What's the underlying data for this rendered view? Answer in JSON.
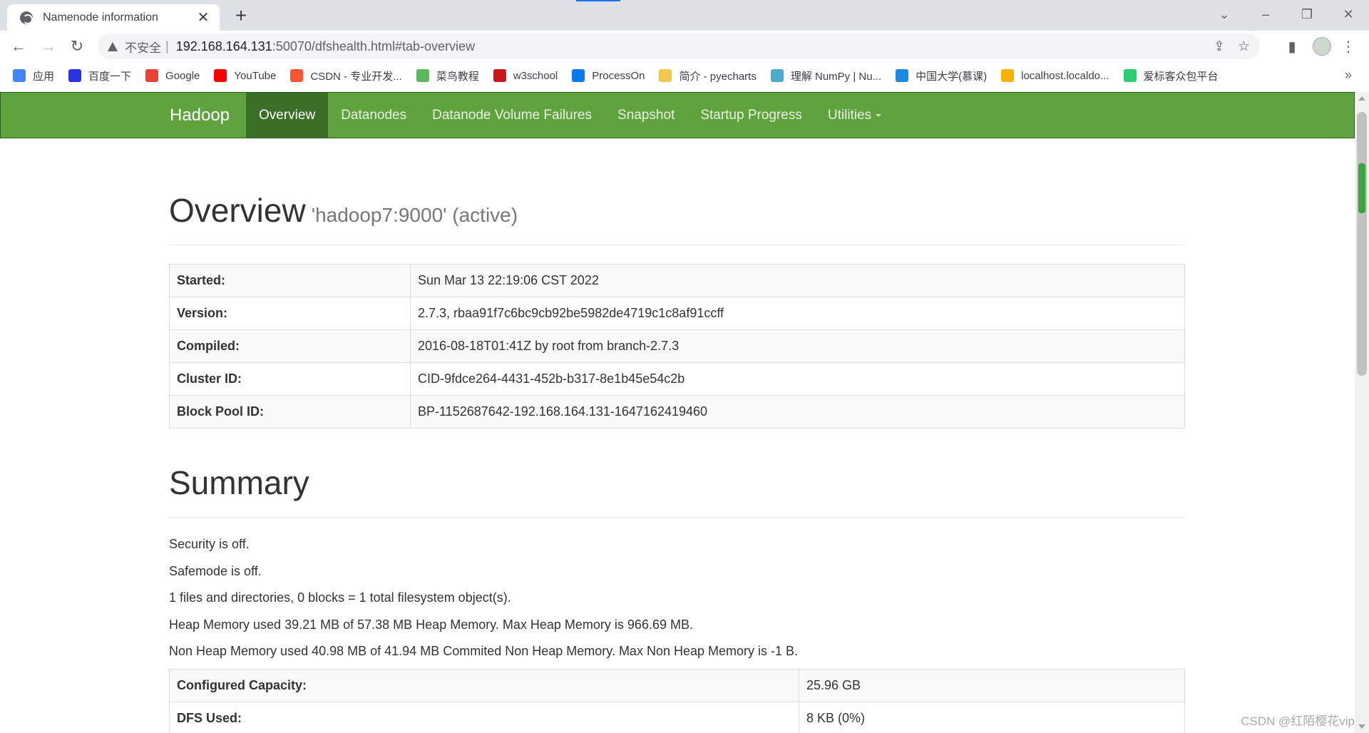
{
  "browser": {
    "tab_title": "Namenode information",
    "insecure_label": "不安全",
    "url_host": "192.168.164.131",
    "url_rest": ":50070/dfshealth.html#tab-overview"
  },
  "bookmarks": [
    {
      "label": "应用",
      "icon": "apps-grid-icon",
      "color": "#4285f4"
    },
    {
      "label": "百度一下",
      "icon": "baidu-icon",
      "color": "#2932e1"
    },
    {
      "label": "Google",
      "icon": "google-icon",
      "color": "#ea4335"
    },
    {
      "label": "YouTube",
      "icon": "youtube-icon",
      "color": "#ff0000"
    },
    {
      "label": "CSDN - 专业开发...",
      "icon": "csdn-icon",
      "color": "#fc5531"
    },
    {
      "label": "菜鸟教程",
      "icon": "runoob-icon",
      "color": "#5cb85c"
    },
    {
      "label": "w3school",
      "icon": "w3school-icon",
      "color": "#c7161d"
    },
    {
      "label": "ProcessOn",
      "icon": "processon-icon",
      "color": "#067bef"
    },
    {
      "label": "简介 - pyecharts",
      "icon": "pyecharts-icon",
      "color": "#f2c94c"
    },
    {
      "label": "理解 NumPy | Nu...",
      "icon": "numpy-icon",
      "color": "#4dabcf"
    },
    {
      "label": "中国大学(慕课)",
      "icon": "mooc-icon",
      "color": "#1e88e5"
    },
    {
      "label": "localhost.localdo...",
      "icon": "localhost-icon",
      "color": "#f4b400"
    },
    {
      "label": "爱标客众包平台",
      "icon": "aibiaoke-icon",
      "color": "#2ecc71"
    }
  ],
  "navbar": {
    "brand": "Hadoop",
    "items": [
      "Overview",
      "Datanodes",
      "Datanode Volume Failures",
      "Snapshot",
      "Startup Progress",
      "Utilities"
    ],
    "active_index": 0,
    "color": "#5fa33e"
  },
  "overview": {
    "title": "Overview",
    "subtitle": "'hadoop7:9000' (active)",
    "rows": [
      {
        "key": "Started:",
        "value": "Sun Mar 13 22:19:06 CST 2022"
      },
      {
        "key": "Version:",
        "value": "2.7.3, rbaa91f7c6bc9cb92be5982de4719c1c8af91ccff"
      },
      {
        "key": "Compiled:",
        "value": "2016-08-18T01:41Z by root from branch-2.7.3"
      },
      {
        "key": "Cluster ID:",
        "value": "CID-9fdce264-4431-452b-b317-8e1b45e54c2b"
      },
      {
        "key": "Block Pool ID:",
        "value": "BP-1152687642-192.168.164.131-1647162419460"
      }
    ]
  },
  "summary": {
    "title": "Summary",
    "lines": [
      "Security is off.",
      "Safemode is off.",
      "1 files and directories, 0 blocks = 1 total filesystem object(s).",
      "Heap Memory used 39.21 MB of 57.38 MB Heap Memory. Max Heap Memory is 966.69 MB.",
      "Non Heap Memory used 40.98 MB of 41.94 MB Commited Non Heap Memory. Max Non Heap Memory is -1 B."
    ],
    "rows": [
      {
        "key": "Configured Capacity:",
        "value": "25.96 GB"
      },
      {
        "key": "DFS Used:",
        "value": "8 KB (0%)"
      }
    ]
  },
  "watermark": "CSDN @红陌樱花vip"
}
